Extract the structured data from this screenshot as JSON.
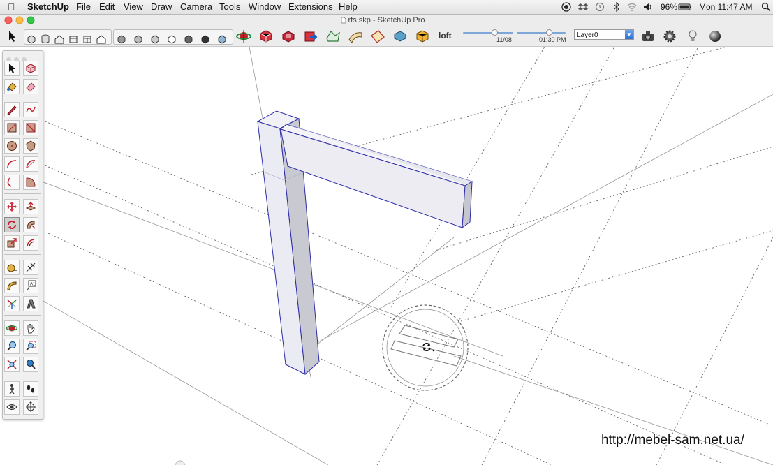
{
  "menubar": {
    "apple": "",
    "app_name": "SketchUp",
    "items": [
      "File",
      "Edit",
      "View",
      "Draw",
      "Camera",
      "Tools",
      "Window",
      "Extensions",
      "Help"
    ],
    "battery": "96%",
    "clock": "Mon 11:47 AM"
  },
  "window": {
    "title": "rfs.skp - SketchUp Pro"
  },
  "toolbar": {
    "loft_label": "loft",
    "date_label": "11/08",
    "time_label": "01:30 PM",
    "date_value": 0.62,
    "time_value": 0.65,
    "layer": "Layer0"
  },
  "viewport": {
    "protractor_icon": "rotate-cursor-icon"
  },
  "watermark": "http://mebel-sam.net.ua/"
}
